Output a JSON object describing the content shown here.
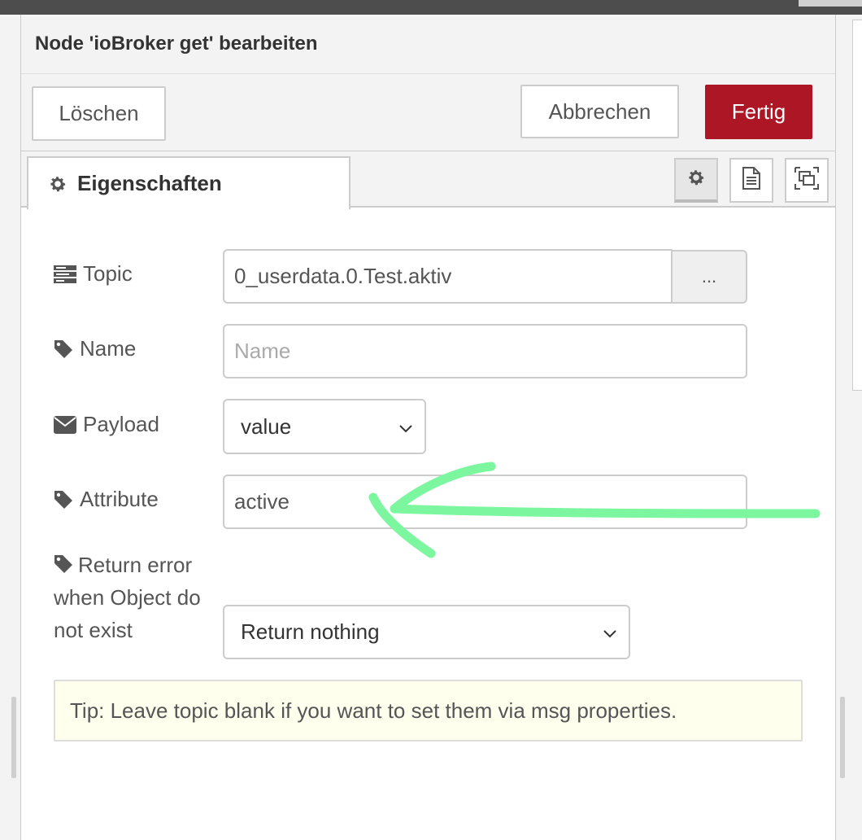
{
  "tray": {
    "title": "Node 'ioBroker get' bearbeiten"
  },
  "toolbar": {
    "delete_label": "Löschen",
    "cancel_label": "Abbrechen",
    "done_label": "Fertig"
  },
  "tabs": {
    "properties_label": "Eigenschaften",
    "icons": [
      "gear-icon",
      "document-icon",
      "layout-icon"
    ]
  },
  "form": {
    "topic": {
      "label": "Topic",
      "value": "0_userdata.0.Test.aktiv",
      "browse_label": "..."
    },
    "name": {
      "label": "Name",
      "placeholder": "Name"
    },
    "payload": {
      "label": "Payload",
      "selected": "value"
    },
    "attribute": {
      "label": "Attribute",
      "value": "active"
    },
    "return_error": {
      "label": "Return error when Object do not exist",
      "selected": "Return nothing"
    }
  },
  "tip": "Tip: Leave topic blank if you want to set them via msg properties.",
  "colors": {
    "accent_red": "#ad1625",
    "arrow_green": "#7cf7a0",
    "tip_background": "#ffffee"
  }
}
